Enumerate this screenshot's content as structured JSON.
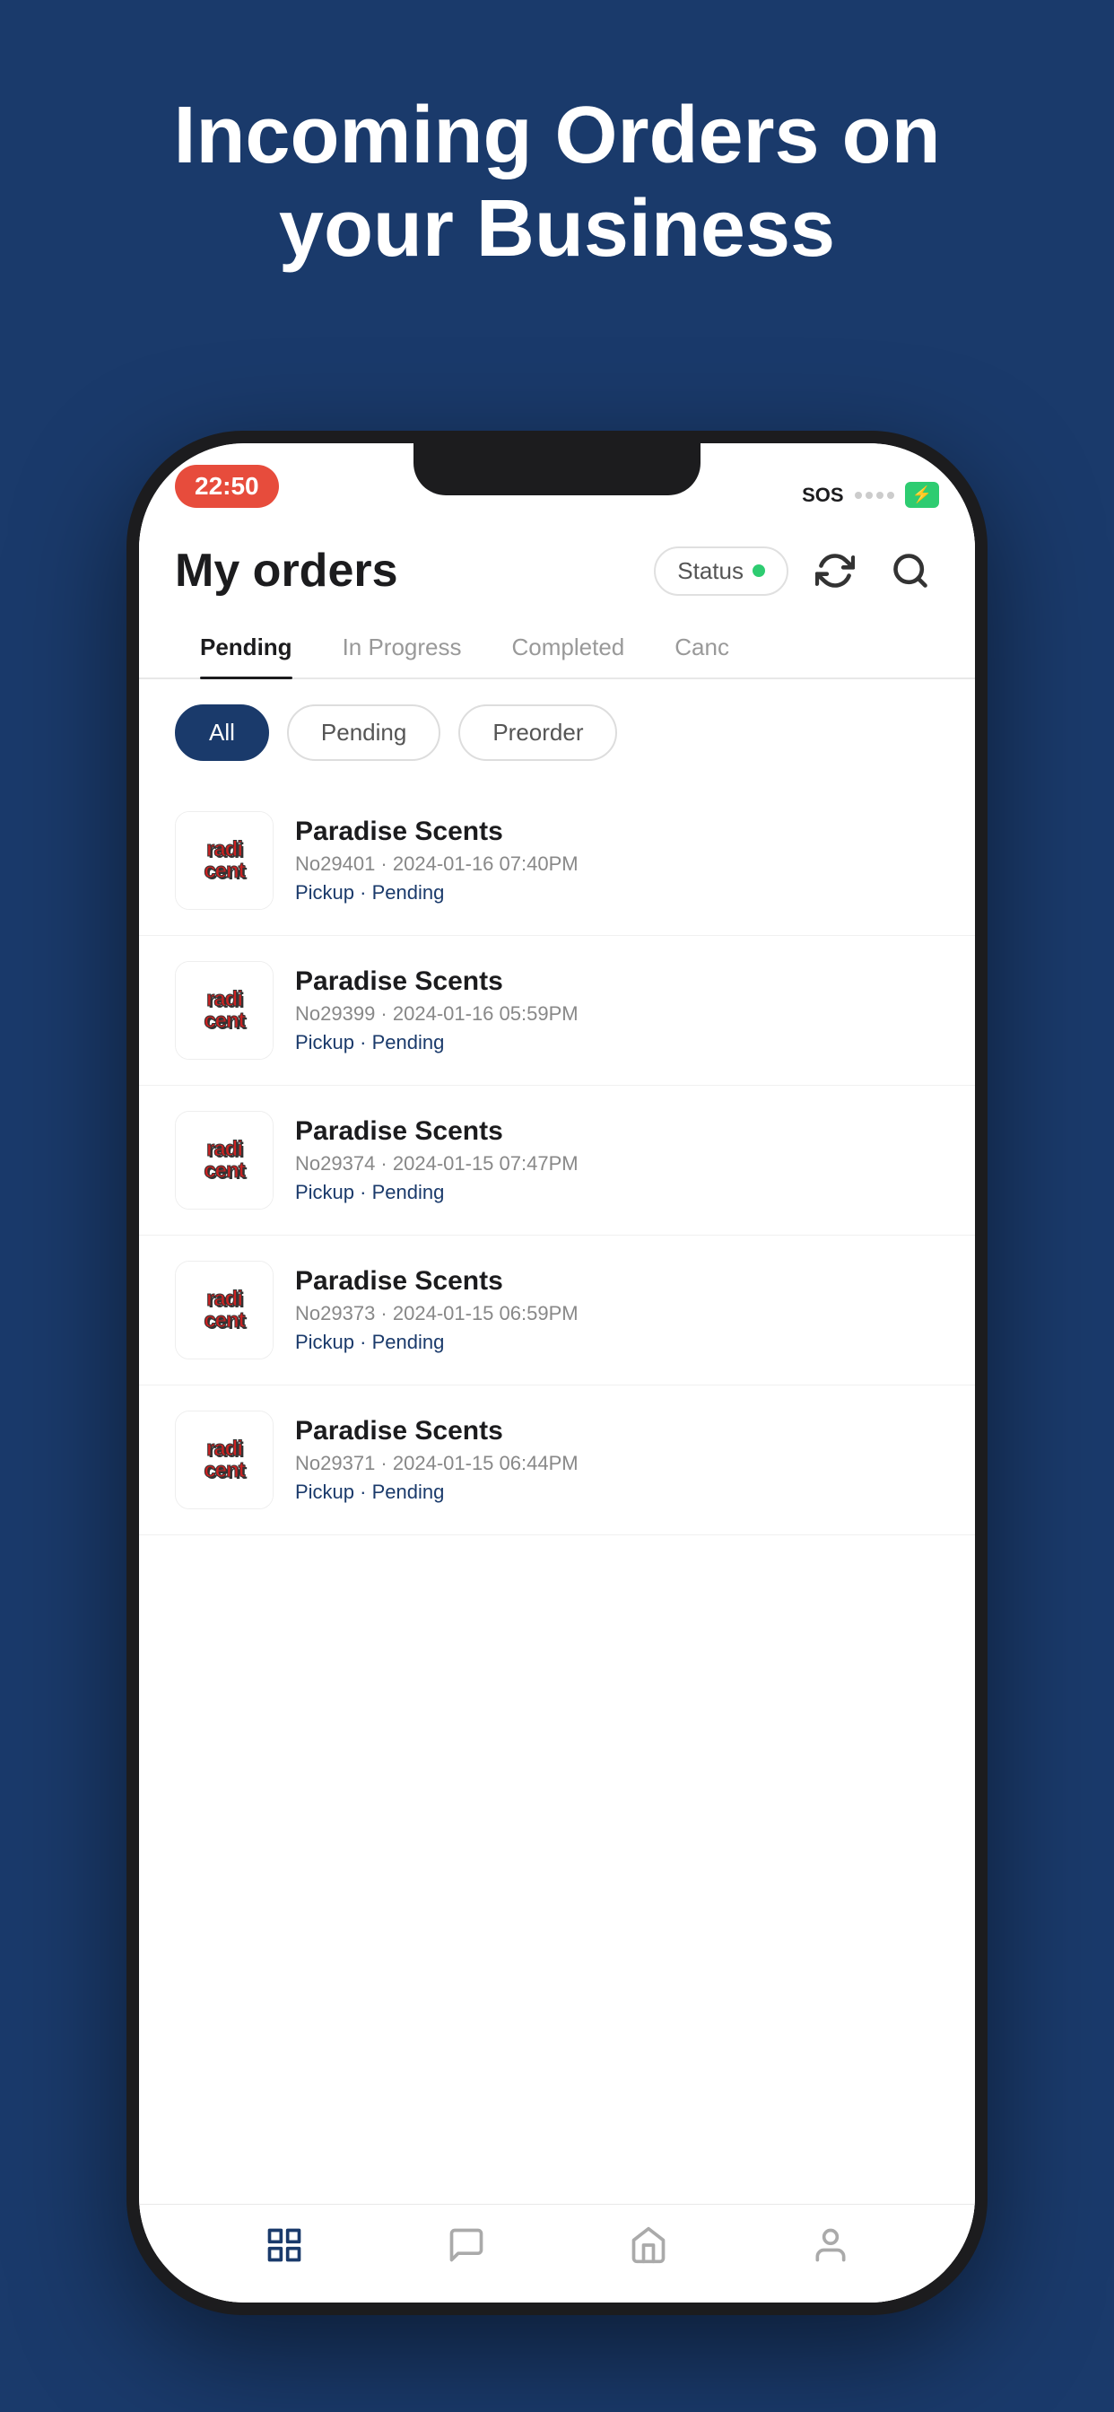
{
  "background": {
    "color": "#1a3a6b"
  },
  "hero": {
    "title": "Incoming Orders on your Business"
  },
  "phone": {
    "status_bar": {
      "time": "22:50",
      "sos": "SOS",
      "battery_icon": "⚡"
    },
    "header": {
      "title": "My orders",
      "status_label": "Status",
      "refresh_icon": "refresh-icon",
      "search_icon": "search-icon"
    },
    "tabs": [
      {
        "label": "Pending",
        "active": true
      },
      {
        "label": "In Progress",
        "active": false
      },
      {
        "label": "Completed",
        "active": false
      },
      {
        "label": "Canc",
        "active": false
      }
    ],
    "filters": [
      {
        "label": "All",
        "active": true
      },
      {
        "label": "Pending",
        "active": false
      },
      {
        "label": "Preorder",
        "active": false
      }
    ],
    "orders": [
      {
        "name": "Paradise Scents",
        "order_no": "No29401",
        "date": "2024-01-16 07:40PM",
        "type": "Pickup",
        "status": "Pending"
      },
      {
        "name": "Paradise Scents",
        "order_no": "No29399",
        "date": "2024-01-16 05:59PM",
        "type": "Pickup",
        "status": "Pending"
      },
      {
        "name": "Paradise Scents",
        "order_no": "No29374",
        "date": "2024-01-15 07:47PM",
        "type": "Pickup",
        "status": "Pending"
      },
      {
        "name": "Paradise Scents",
        "order_no": "No29373",
        "date": "2024-01-15 06:59PM",
        "type": "Pickup",
        "status": "Pending"
      },
      {
        "name": "Paradise Scents",
        "order_no": "No29371",
        "date": "2024-01-15 06:44PM",
        "type": "Pickup",
        "status": "Pending"
      }
    ],
    "bottom_nav": [
      {
        "icon": "orders-icon"
      },
      {
        "icon": "chat-icon"
      },
      {
        "icon": "store-icon"
      },
      {
        "icon": "profile-icon"
      }
    ]
  }
}
